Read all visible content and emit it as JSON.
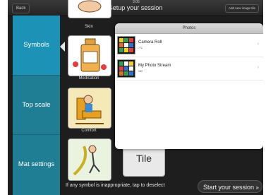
{
  "topbar": {
    "back_label": "Back",
    "clock": "3:05",
    "title": "Setup your session",
    "add_label": "Add new image tile"
  },
  "sidebar": {
    "items": [
      {
        "label": "Symbols",
        "active": true
      },
      {
        "label": "Top scale",
        "active": false
      },
      {
        "label": "Mat settings",
        "active": false
      }
    ]
  },
  "tiles": {
    "skin_label": "Skin",
    "medication_label": "Medication",
    "comfort_label": "Comfort",
    "blank_label": "Blank Tile"
  },
  "footer": {
    "hint": "If any symbol is inappropriate, tap to deselect",
    "start_button": "Start your session",
    "start_icon": "chevron-right-double-icon"
  },
  "photos_popover": {
    "title": "Photos",
    "albums": [
      {
        "name": "Camera Roll",
        "count": "772"
      },
      {
        "name": "My Photo Stream",
        "count": "183"
      }
    ]
  },
  "colors": {
    "sidebar": "#1f7d94",
    "sidebar_active": "#1c93b6",
    "background": "#1e1e1e"
  }
}
